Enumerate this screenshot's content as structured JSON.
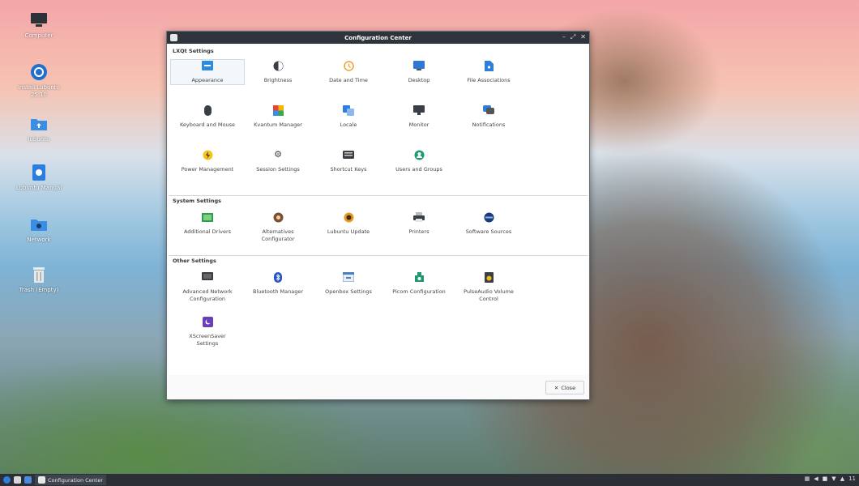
{
  "desktop": {
    "icons": [
      {
        "label": "Computer",
        "icon": "computer-icon"
      },
      {
        "label": "Install Lubuntu\n25.10",
        "icon": "installer-icon"
      },
      {
        "label": "lubuntu",
        "icon": "home-folder-icon"
      },
      {
        "label": "Lubuntu Manual",
        "icon": "manual-icon"
      },
      {
        "label": "Network",
        "icon": "network-folder-icon"
      },
      {
        "label": "Trash (Empty)",
        "icon": "trash-icon"
      }
    ]
  },
  "window": {
    "title": "Configuration Center",
    "controls": {
      "minimize": "–",
      "maximize": "⤢",
      "close": "✕"
    },
    "close_button": {
      "icon": "✕",
      "label": "Close"
    },
    "sections": [
      {
        "header": "LXQt Settings",
        "items": [
          {
            "label": "Appearance",
            "icon": "appearance-icon"
          },
          {
            "label": "Brightness",
            "icon": "brightness-icon"
          },
          {
            "label": "Date and Time",
            "icon": "clock-icon"
          },
          {
            "label": "Desktop",
            "icon": "desktop-icon"
          },
          {
            "label": "File Associations",
            "icon": "file-associations-icon"
          },
          {
            "label": "Keyboard and Mouse",
            "icon": "mouse-icon"
          },
          {
            "label": "Kvantum Manager",
            "icon": "kvantum-icon"
          },
          {
            "label": "Locale",
            "icon": "locale-icon"
          },
          {
            "label": "Monitor",
            "icon": "monitor-icon"
          },
          {
            "label": "Notifications",
            "icon": "notifications-icon"
          },
          {
            "label": "Power Management",
            "icon": "power-icon"
          },
          {
            "label": "Session Settings",
            "icon": "gear-icon"
          },
          {
            "label": "Shortcut Keys",
            "icon": "keyboard-icon"
          },
          {
            "label": "Users and Groups",
            "icon": "user-icon"
          }
        ]
      },
      {
        "header": "System Settings",
        "items": [
          {
            "label": "Additional Drivers",
            "icon": "driver-icon"
          },
          {
            "label": "Alternatives\nConfigurator",
            "icon": "alternatives-icon"
          },
          {
            "label": "Lubuntu Update",
            "icon": "update-icon"
          },
          {
            "label": "Printers",
            "icon": "printer-icon"
          },
          {
            "label": "Software Sources",
            "icon": "software-sources-icon"
          }
        ]
      },
      {
        "header": "Other Settings",
        "items": [
          {
            "label": "Advanced Network\nConfiguration",
            "icon": "network-icon"
          },
          {
            "label": "Bluetooth Manager",
            "icon": "bluetooth-icon"
          },
          {
            "label": "Openbox Settings",
            "icon": "openbox-icon"
          },
          {
            "label": "Picom Configuration",
            "icon": "picom-icon"
          },
          {
            "label": "PulseAudio Volume\nControl",
            "icon": "volume-icon"
          },
          {
            "label": "XScreenSaver\nSettings",
            "icon": "screensaver-icon"
          }
        ]
      }
    ]
  },
  "taskbar": {
    "task_label": "Configuration Center",
    "clock": "11"
  }
}
